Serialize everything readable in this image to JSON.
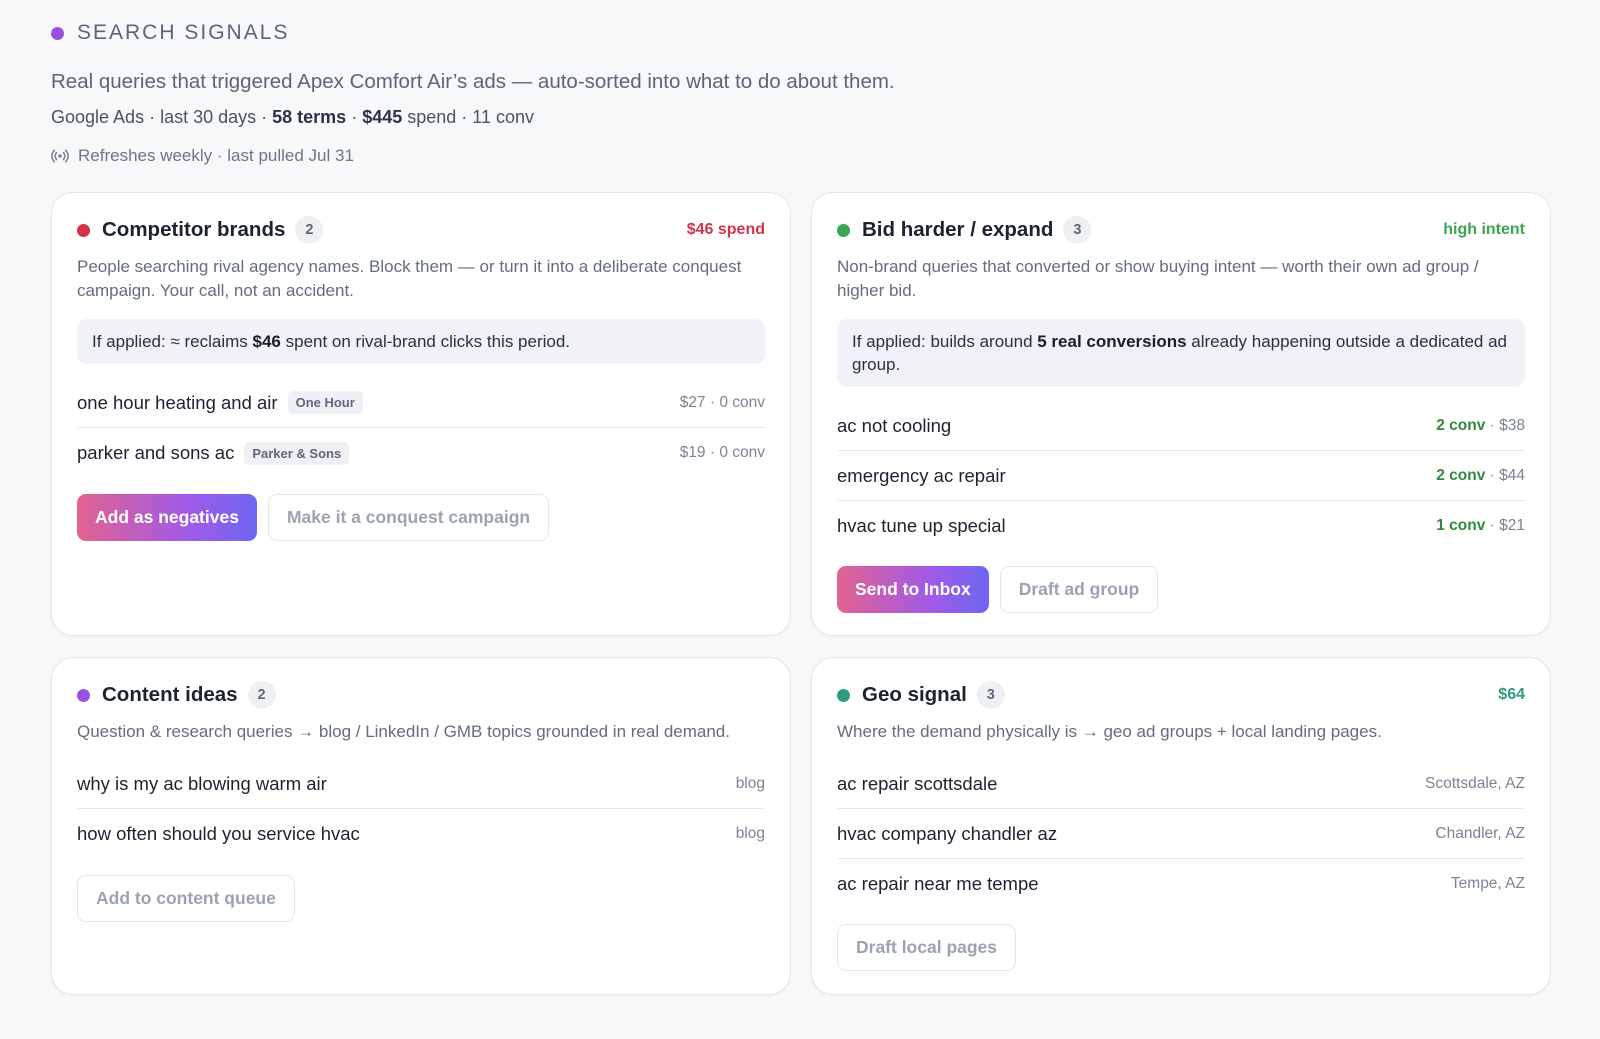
{
  "header": {
    "eyebrow": "SEARCH SIGNALS",
    "lede": "Real queries that triggered Apex Comfort Air’s ads — auto-sorted into what to do about them.",
    "meta_source": "Google Ads · last 30 days · ",
    "meta_terms": "58 terms",
    "meta_sep": " · ",
    "meta_spend": "$445",
    "meta_tail": " spend · 11 conv",
    "refresh": "Refreshes weekly · last pulled Jul 31",
    "refresh_icon": "broadcast-icon"
  },
  "cards": {
    "competitor": {
      "title": "Competitor brands",
      "count": "2",
      "tag": "$46 spend",
      "color": "#d1334a",
      "description": "People searching rival agency names. Block them — or turn it into a deliberate conquest campaign. Your call, not an accident.",
      "impact_pre": "If applied: ≈ reclaims ",
      "impact_bold": "$46",
      "impact_post": " spent on rival-brand clicks this period.",
      "rows": [
        {
          "term": "one hour heating and air",
          "chip": "One Hour",
          "stat": "$27 · 0 conv"
        },
        {
          "term": "parker and sons ac",
          "chip": "Parker & Sons",
          "stat": "$19 · 0 conv"
        }
      ],
      "primary": "Add as negatives",
      "secondary": "Make it a conquest campaign"
    },
    "bid": {
      "title": "Bid harder / expand",
      "count": "3",
      "tag": "high intent",
      "color": "#3aa552",
      "description": "Non-brand queries that converted or show buying intent — worth their own ad group / higher bid.",
      "impact_pre": "If applied: builds around ",
      "impact_bold": "5 real conversions",
      "impact_post": " already happening outside a dedicated ad group.",
      "rows": [
        {
          "term": "ac not cooling",
          "conv": "2 conv",
          "spend": " · $38"
        },
        {
          "term": "emergency ac repair",
          "conv": "2 conv",
          "spend": " · $44"
        },
        {
          "term": "hvac tune up special",
          "conv": "1 conv",
          "spend": " · $21"
        }
      ],
      "primary": "Send to Inbox",
      "secondary": "Draft ad group"
    },
    "content": {
      "title": "Content ideas",
      "count": "2",
      "color": "#9b51e0",
      "description": "Question & research queries → blog / LinkedIn / GMB topics grounded in real demand.",
      "rows": [
        {
          "term": "why is my ac blowing warm air",
          "stat": "blog"
        },
        {
          "term": "how often should you service hvac",
          "stat": "blog"
        }
      ],
      "secondary": "Add to content queue"
    },
    "geo": {
      "title": "Geo signal",
      "count": "3",
      "tag": "$64",
      "color": "#2f9a7e",
      "description": "Where the demand physically is → geo ad groups + local landing pages.",
      "rows": [
        {
          "term": "ac repair scottsdale",
          "stat": "Scottsdale, AZ"
        },
        {
          "term": "hvac company chandler az",
          "stat": "Chandler, AZ"
        },
        {
          "term": "ac repair near me tempe",
          "stat": "Tempe, AZ"
        }
      ],
      "secondary": "Draft local pages"
    }
  }
}
